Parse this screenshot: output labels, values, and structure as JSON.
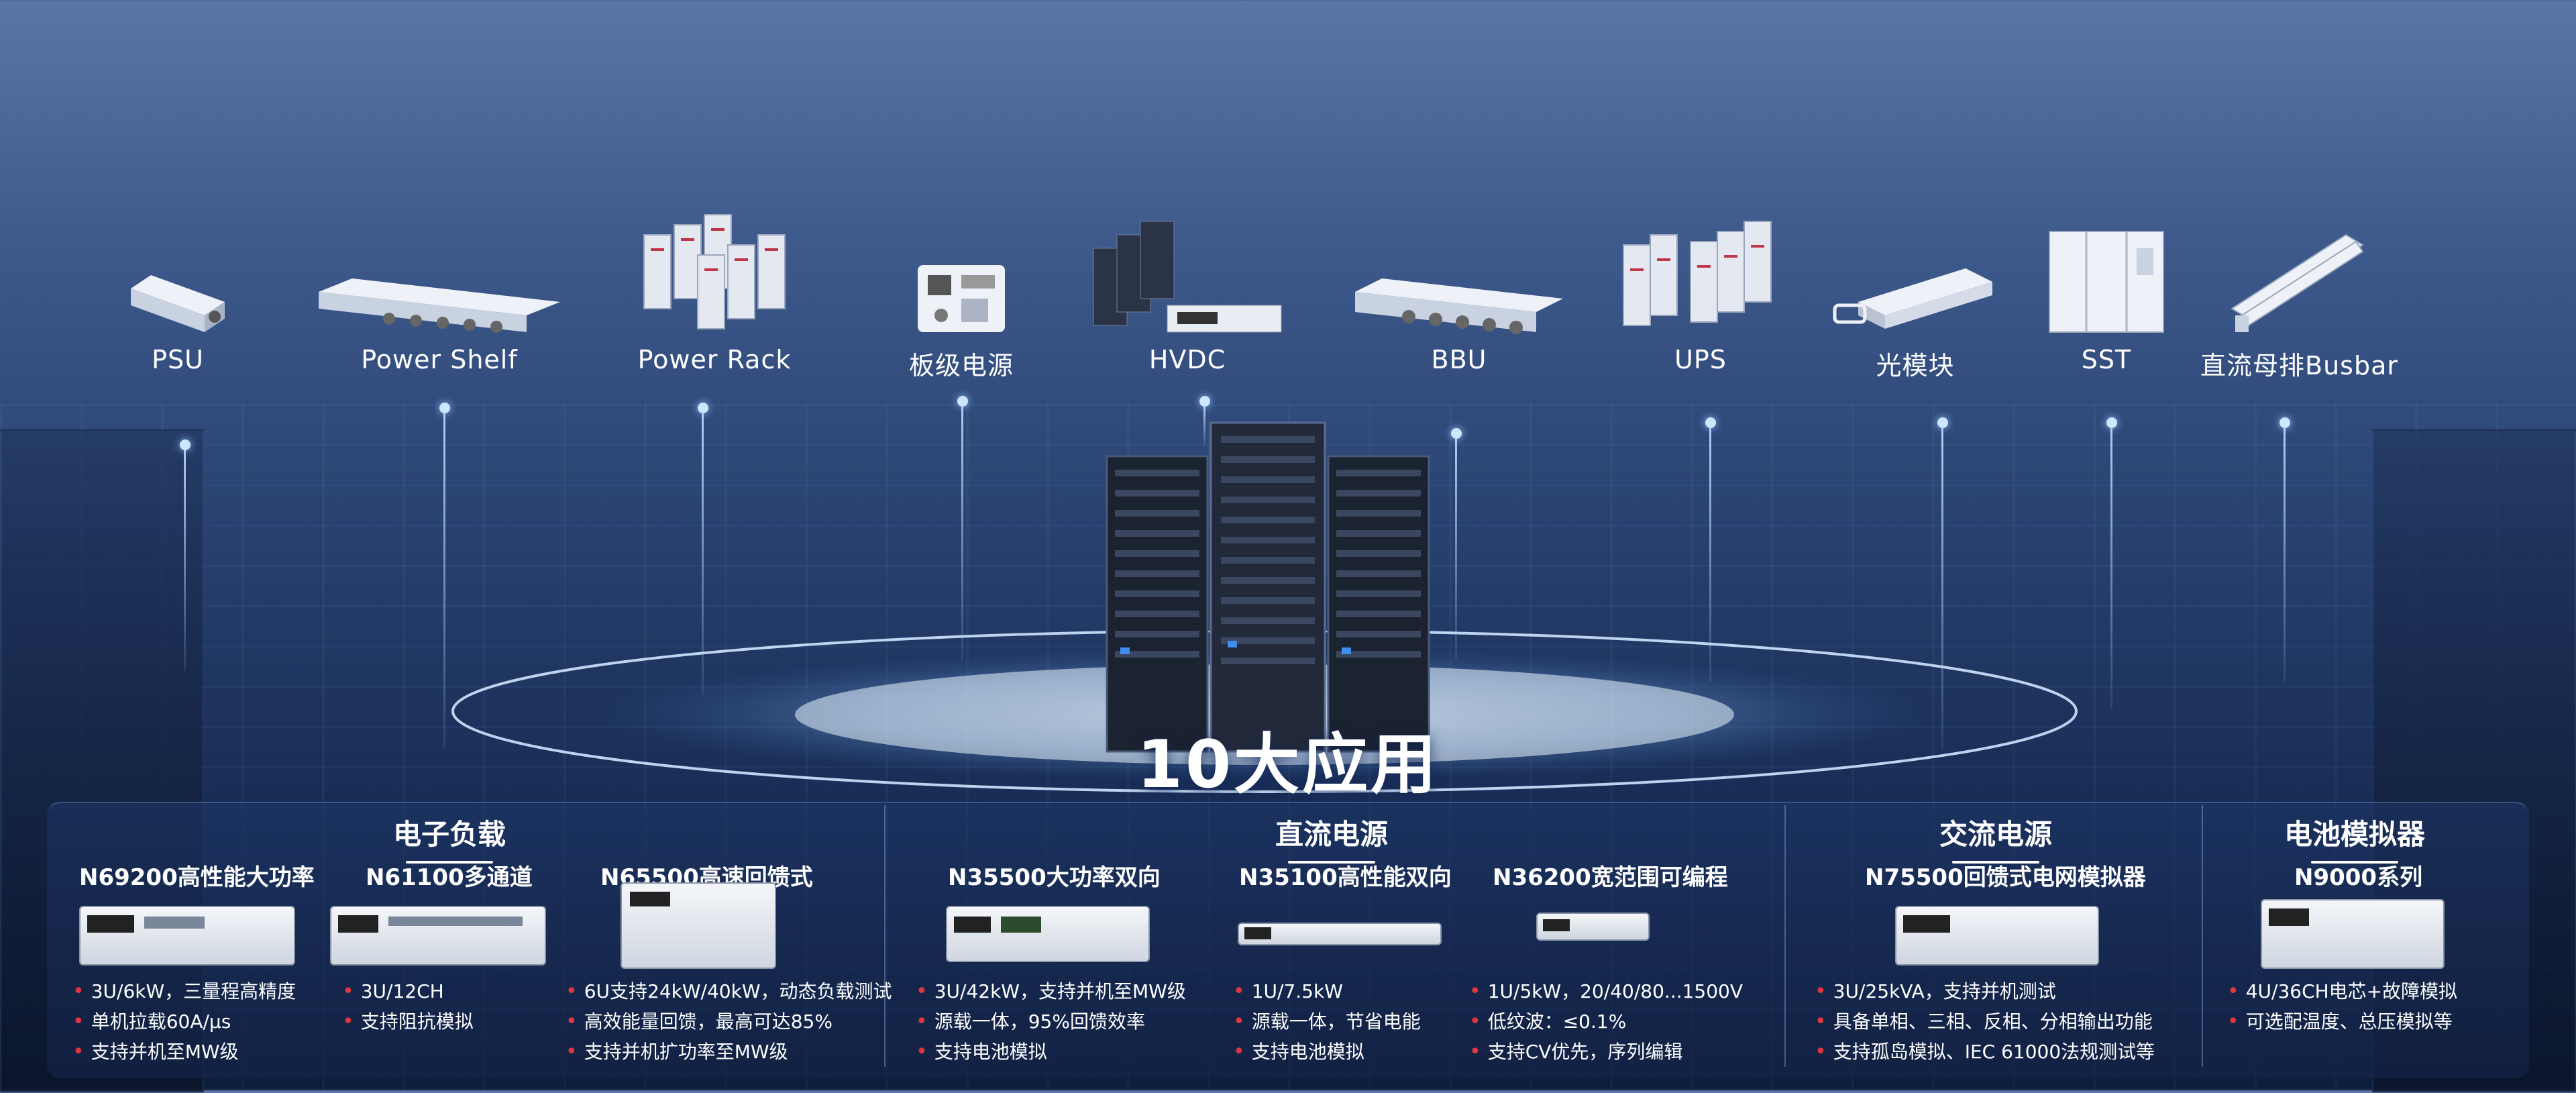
{
  "title": "10大应用",
  "applications": [
    {
      "label": "PSU",
      "icon": "psu-icon"
    },
    {
      "label": "Power Shelf",
      "icon": "power-shelf-icon"
    },
    {
      "label": "Power Rack",
      "icon": "power-rack-icon"
    },
    {
      "label": "板级电源",
      "icon": "board-power-icon"
    },
    {
      "label": "HVDC",
      "icon": "hvdc-icon"
    },
    {
      "label": "BBU",
      "icon": "bbu-icon"
    },
    {
      "label": "UPS",
      "icon": "ups-icon"
    },
    {
      "label": "光模块",
      "icon": "optical-module-icon"
    },
    {
      "label": "SST",
      "icon": "sst-icon"
    },
    {
      "label": "直流母排Busbar",
      "icon": "busbar-icon"
    }
  ],
  "categories": {
    "electronic_load": "电子负载",
    "dc_power": "直流电源",
    "ac_power": "交流电源",
    "battery_simulator": "电池模拟器"
  },
  "products": [
    {
      "name": "N69200高性能大功率",
      "specs": [
        "3U/6kW，三量程高精度",
        "单机拉载60A/μs",
        "支持并机至MW级"
      ]
    },
    {
      "name": "N61100多通道",
      "specs": [
        "3U/12CH",
        "支持阻抗模拟"
      ]
    },
    {
      "name": "N65500高速回馈式",
      "specs": [
        "6U支持24kW/40kW，动态负载测试",
        "高效能量回馈，最高可达85%",
        "支持并机扩功率至MW级"
      ]
    },
    {
      "name": "N35500大功率双向",
      "specs": [
        "3U/42kW，支持并机至MW级",
        "源载一体，95%回馈效率",
        "支持电池模拟"
      ]
    },
    {
      "name": "N35100高性能双向",
      "specs": [
        "1U/7.5kW",
        "源载一体，节省电能",
        "支持电池模拟"
      ]
    },
    {
      "name": "N36200宽范围可编程",
      "specs": [
        "1U/5kW，20/40/80...1500V",
        "低纹波：≤0.1%",
        "支持CV优先，序列编辑"
      ]
    },
    {
      "name": "N75500回馈式电网模拟器",
      "specs": [
        "3U/25kVA，支持并机测试",
        "具备单相、三相、反相、分相输出功能",
        "支持孤岛模拟、IEC 61000法规测试等"
      ]
    },
    {
      "name": "N9000系列",
      "specs": [
        "4U/36CH电芯+故障模拟",
        "可选配温度、总压模拟等"
      ]
    }
  ],
  "colors": {
    "bullet": "#e0363f",
    "accent_line": "#cfe6ff"
  }
}
